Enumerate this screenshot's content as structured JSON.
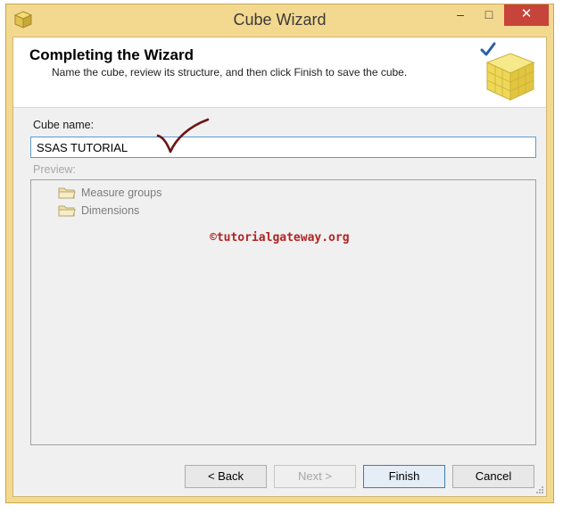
{
  "window": {
    "title": "Cube Wizard",
    "minimize_glyph": "–",
    "maximize_glyph": "□",
    "close_glyph": "✕",
    "accent_close": "#c7443a",
    "frame_color": "#f3d990"
  },
  "header": {
    "title": "Completing the Wizard",
    "subtitle": "Name the cube, review its structure, and then click Finish to save the cube.",
    "graphic_icon": "cube-check-icon"
  },
  "form": {
    "cube_name_label": "Cube name:",
    "cube_name_value": "SSAS TUTORIAL",
    "preview_label": "Preview:"
  },
  "preview": {
    "items": [
      {
        "label": "Measure groups",
        "icon": "folder-icon"
      },
      {
        "label": "Dimensions",
        "icon": "folder-icon"
      }
    ],
    "watermark": "©tutorialgateway.org"
  },
  "buttons": {
    "back": "< Back",
    "next": "Next >",
    "finish": "Finish",
    "cancel": "Cancel"
  }
}
